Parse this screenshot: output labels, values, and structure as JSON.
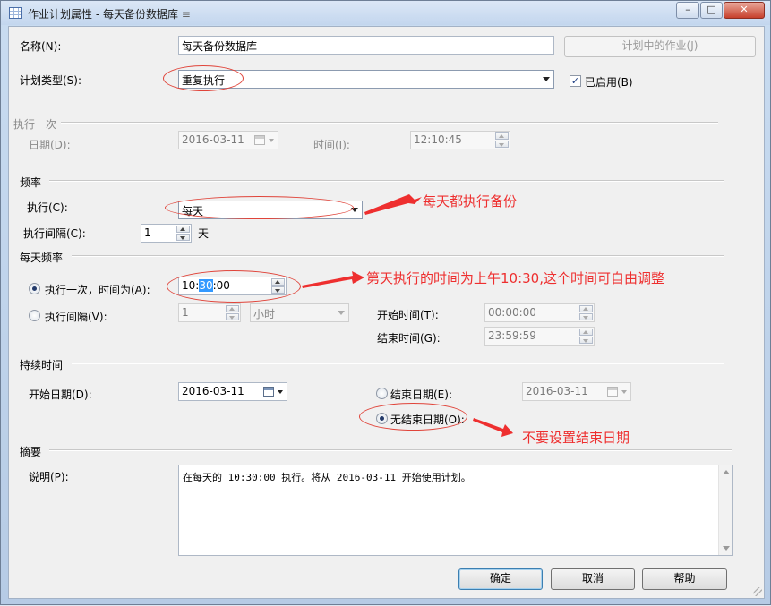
{
  "window": {
    "title": "作业计划属性 - 每天备份数据库",
    "title_suffix": "≡",
    "controls": {
      "minimize": "–",
      "maximize": "□",
      "close": "✕"
    }
  },
  "general": {
    "name_label": "名称(N):",
    "name_value": "每天备份数据库",
    "jobs_button": "计划中的作业(J)",
    "type_label": "计划类型(S):",
    "type_value": "重复执行",
    "enabled_label": "已启用(B)",
    "enabled_checked": true
  },
  "once": {
    "section": "执行一次",
    "date_label": "日期(D):",
    "date_value": "2016-03-11",
    "time_label": "时间(I):",
    "time_value": "12:10:45"
  },
  "frequency": {
    "section": "频率",
    "exec_label": "执行(C):",
    "exec_value": "每天",
    "interval_label": "执行间隔(C):",
    "interval_value": "1",
    "interval_unit": "天"
  },
  "daily": {
    "section": "每天频率",
    "once_label": "执行一次，时间为(A):",
    "once_time_pre": "10:",
    "once_time_sel": "30",
    "once_time_post": ":00",
    "once_selected": true,
    "every_label": "执行间隔(V):",
    "every_value": "1",
    "every_unit": "小时",
    "start_label": "开始时间(T):",
    "start_value": "00:00:00",
    "end_label": "结束时间(G):",
    "end_value": "23:59:59"
  },
  "duration": {
    "section": "持续时间",
    "start_label": "开始日期(D):",
    "start_value": "2016-03-11",
    "end_label": "结束日期(E):",
    "end_value": "2016-03-11",
    "no_end_label": "无结束日期(O):",
    "no_end_selected": true
  },
  "summary": {
    "section": "摘要",
    "desc_label": "说明(P):",
    "desc_value": "在每天的 10:30:00 执行。将从 2016-03-11 开始使用计划。"
  },
  "buttons": {
    "ok": "确定",
    "cancel": "取消",
    "help": "帮助"
  },
  "annotations": {
    "a1": "每天都执行备份",
    "a2": "第天执行的时间为上午10:30,这个时间可自由调整",
    "a3": "不要设置结束日期"
  },
  "colors": {
    "annotation": "#ee2f2f",
    "selection": "#3399ff"
  }
}
